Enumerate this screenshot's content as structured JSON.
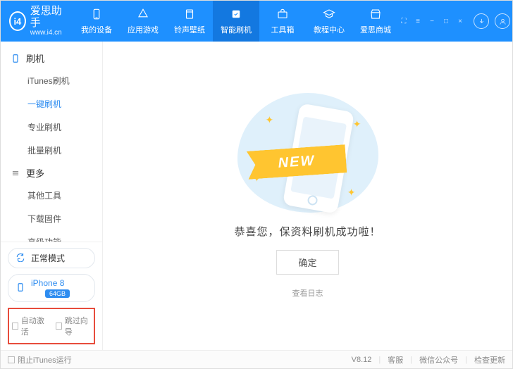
{
  "brand": {
    "logo_text": "i4",
    "name": "爱思助手",
    "url": "www.i4.cn"
  },
  "nav": {
    "tabs": [
      {
        "label": "我的设备"
      },
      {
        "label": "应用游戏"
      },
      {
        "label": "铃声壁纸"
      },
      {
        "label": "智能刷机"
      },
      {
        "label": "工具箱"
      },
      {
        "label": "教程中心"
      },
      {
        "label": "爱思商城"
      }
    ]
  },
  "sidebar": {
    "section1_title": "刷机",
    "section1_items": [
      "iTunes刷机",
      "一键刷机",
      "专业刷机",
      "批量刷机"
    ],
    "section2_title": "更多",
    "section2_items": [
      "其他工具",
      "下载固件",
      "高级功能"
    ],
    "status_chip": "正常模式",
    "device_name": "iPhone 8",
    "device_capacity": "64GB",
    "auto_activate": "自动激活",
    "skip_guide": "跳过向导"
  },
  "main": {
    "ribbon_text": "NEW",
    "message": "恭喜您，保资料刷机成功啦！",
    "ok": "确定",
    "view_log": "查看日志"
  },
  "statusbar": {
    "block_itunes": "阻止iTunes运行",
    "version": "V8.12",
    "support": "客服",
    "wechat": "微信公众号",
    "check_update": "检查更新"
  }
}
